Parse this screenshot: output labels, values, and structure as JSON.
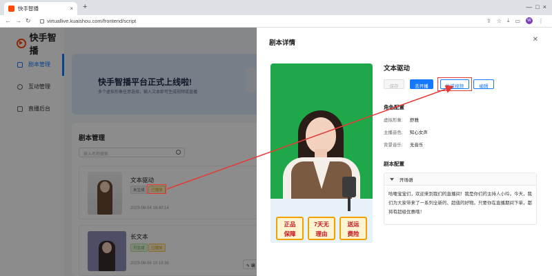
{
  "browser": {
    "tab_title": "快手智播",
    "url": "virtuallive.kuaishou.com/frontend/script",
    "avatar_letter": "W"
  },
  "app": {
    "logo": "快手智播",
    "menu": [
      {
        "label": "剧本管理",
        "icon": "document-icon",
        "active": true
      },
      {
        "label": "互动管理",
        "icon": "chat-icon",
        "active": false
      },
      {
        "label": "直播后台",
        "icon": "monitor-icon",
        "active": false
      }
    ],
    "banner": {
      "title": "快手智播平台正式上线啦!",
      "subtitle": "多个虚拟形象任意选择，输入文本即可生成视频或直播"
    },
    "script_panel": {
      "title": "剧本管理",
      "search_placeholder": "输入名称搜索",
      "cards": [
        {
          "title": "文本驱动",
          "tags": [
            "未生成",
            "已播放"
          ],
          "time": "2023-06-04 16:40:14"
        },
        {
          "title": "长文本",
          "tags": [
            "可生成",
            "已播放"
          ],
          "time": "2023-06-06 10:19:36"
        }
      ],
      "edit_label": "编"
    }
  },
  "drawer": {
    "title": "剧本详情",
    "script_name": "文本驱动",
    "buttons": {
      "save": "保存",
      "play": "去开播",
      "generate": "生成视频",
      "edit": "编辑"
    },
    "role_section": {
      "title": "角色配置",
      "rows": [
        {
          "key": "虚拟形象:",
          "value": "舒雅"
        },
        {
          "key": "主播音色:",
          "value": "知心女声"
        },
        {
          "key": "背景音乐:",
          "value": "无音乐"
        }
      ]
    },
    "script_section": {
      "title": "剧本配置",
      "panel_title": "开场语",
      "content": "哈喽宝宝们，欢迎来到我们的直播间！我是你们的主持人小玲。今天，我们为大家带来了一系列全新的、超值的好物。只要你在直播期间下单，都将有超级优惠哦！"
    },
    "stickers": [
      {
        "line1": "正品",
        "line2": "保障"
      },
      {
        "line1": "7天无",
        "line2": "理由"
      },
      {
        "line1": "送运",
        "line2": "费险"
      }
    ]
  },
  "colors": {
    "brand": "#ff4906",
    "primary": "#1677ff",
    "annotation_red": "#e53935",
    "preview_green": "#1fa84a"
  }
}
